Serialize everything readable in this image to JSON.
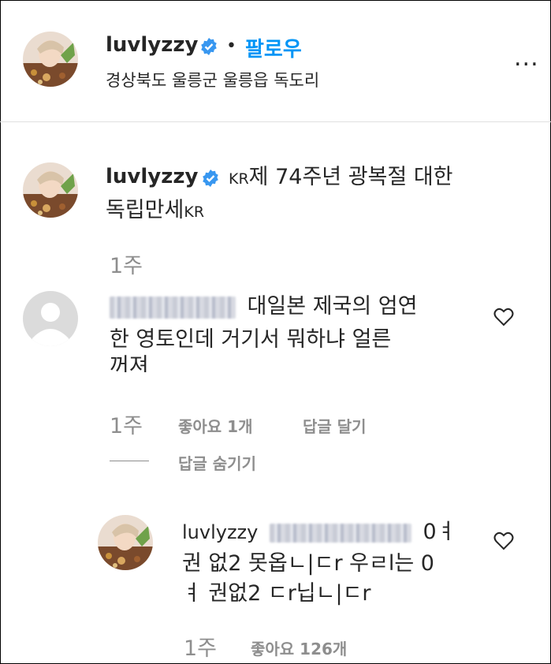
{
  "header": {
    "username": "luvlyzzy",
    "separator": "•",
    "follow_label": "팔로우",
    "location": "경상북도 울릉군 울릉읍 독도리",
    "more_label": "..."
  },
  "caption": {
    "username": "luvlyzzy",
    "flag1": "KR",
    "text_line1": "제 74주년 광복절 대한",
    "text_line2": "독립만세",
    "flag2": "KR",
    "time": "1주"
  },
  "comment1": {
    "text_line1": "대일본 제국의 엄연",
    "text_line2": "한 영토인데 거기서 뭐하냐 얼른",
    "text_line3": "꺼져",
    "time": "1주",
    "likes_label": "좋아요 1개",
    "reply_label": "답글 달기",
    "hide_replies_label": "답글 숨기기"
  },
  "reply1": {
    "username": "luvlyzzy",
    "text_line1": "0ㅕ",
    "text_line2": "권 없2 못옵ㄴ|ㄷr 우ㄹl는 0",
    "text_line3": "ㅕ 권없2 ㄷr닙ㄴ|ㄷr",
    "time": "1주",
    "likes_label": "좋아요 126개"
  },
  "colors": {
    "link_blue": "#0095f6",
    "text_dark": "#262626",
    "text_gray": "#8e8e8e",
    "verified_blue": "#3897f0"
  }
}
